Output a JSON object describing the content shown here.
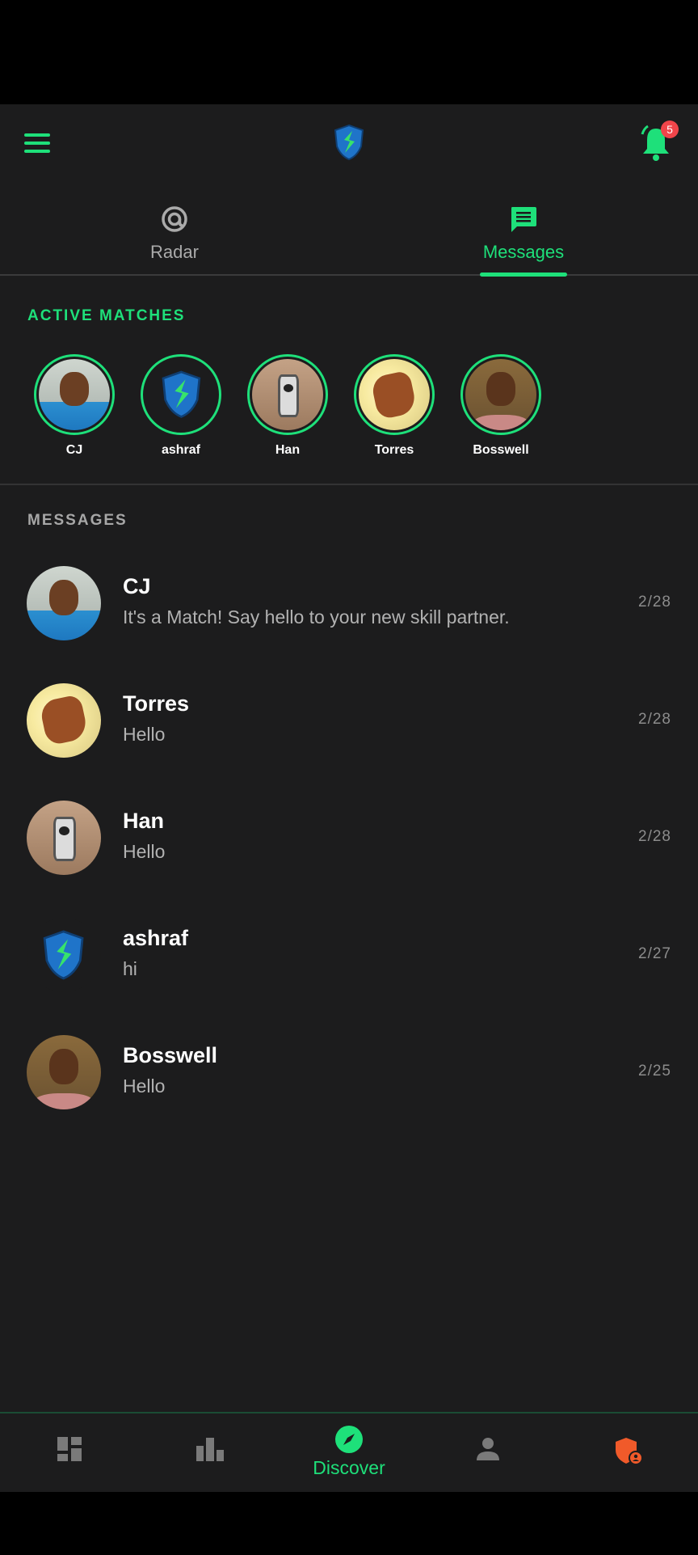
{
  "header": {
    "menu_icon": "hamburger-menu-icon",
    "logo_icon": "shield-bolt-logo-icon",
    "notifications_icon": "bell-icon",
    "notification_count": "5"
  },
  "tabs": [
    {
      "label": "Radar",
      "icon": "radar-icon",
      "active": false
    },
    {
      "label": "Messages",
      "icon": "chat-icon",
      "active": true
    }
  ],
  "active_matches": {
    "title": "ACTIVE MATCHES",
    "items": [
      {
        "name": "CJ"
      },
      {
        "name": "ashraf"
      },
      {
        "name": "Han"
      },
      {
        "name": "Torres"
      },
      {
        "name": "Bosswell"
      }
    ]
  },
  "messages": {
    "title": "MESSAGES",
    "items": [
      {
        "name": "CJ",
        "preview": "It's a Match! Say hello to your new skill partner.",
        "date": "2/28"
      },
      {
        "name": "Torres",
        "preview": "Hello",
        "date": "2/28"
      },
      {
        "name": "Han",
        "preview": "Hello",
        "date": "2/28"
      },
      {
        "name": "ashraf",
        "preview": "hi",
        "date": "2/27"
      },
      {
        "name": "Bosswell",
        "preview": "Hello",
        "date": "2/25"
      }
    ]
  },
  "bottom_nav": {
    "items": [
      {
        "icon": "dashboard-icon",
        "label": ""
      },
      {
        "icon": "leaderboard-icon",
        "label": ""
      },
      {
        "icon": "compass-icon",
        "label": "Discover",
        "active": true
      },
      {
        "icon": "person-icon",
        "label": ""
      },
      {
        "icon": "shield-user-icon",
        "label": ""
      }
    ]
  },
  "colors": {
    "accent": "#1ee07a",
    "background": "#1c1c1d",
    "badge": "#f0454a",
    "shield_orange": "#f05a2a"
  }
}
